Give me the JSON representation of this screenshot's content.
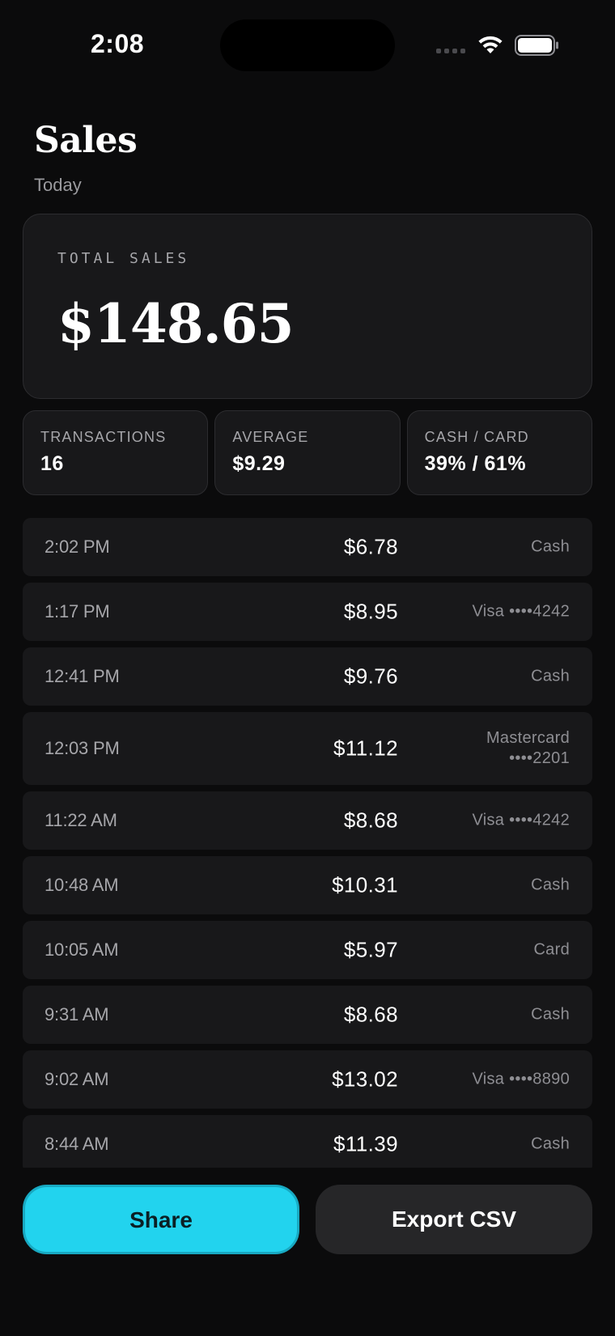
{
  "status_bar": {
    "time": "2:08"
  },
  "header": {
    "title": "Sales",
    "subtitle": "Today"
  },
  "total_card": {
    "label": "TOTAL SALES",
    "value": "$148.65"
  },
  "stats": [
    {
      "label": "TRANSACTIONS",
      "value": "16"
    },
    {
      "label": "AVERAGE",
      "value": "$9.29"
    },
    {
      "label": "CASH / CARD",
      "value": "39% / 61%"
    }
  ],
  "transactions": [
    {
      "time": "2:02 PM",
      "amount": "$6.78",
      "method": [
        "Cash"
      ]
    },
    {
      "time": "1:17 PM",
      "amount": "$8.95",
      "method": [
        "Visa ••••4242"
      ]
    },
    {
      "time": "12:41 PM",
      "amount": "$9.76",
      "method": [
        "Cash"
      ]
    },
    {
      "time": "12:03 PM",
      "amount": "$11.12",
      "method": [
        "Mastercard",
        "••••2201"
      ]
    },
    {
      "time": "11:22 AM",
      "amount": "$8.68",
      "method": [
        "Visa ••••4242"
      ]
    },
    {
      "time": "10:48 AM",
      "amount": "$10.31",
      "method": [
        "Cash"
      ]
    },
    {
      "time": "10:05 AM",
      "amount": "$5.97",
      "method": [
        "Card"
      ]
    },
    {
      "time": "9:31 AM",
      "amount": "$8.68",
      "method": [
        "Cash"
      ]
    },
    {
      "time": "9:02 AM",
      "amount": "$13.02",
      "method": [
        "Visa ••••8890"
      ]
    },
    {
      "time": "8:44 AM",
      "amount": "$11.39",
      "method": [
        "Cash"
      ]
    }
  ],
  "actions": {
    "share_label": "Share",
    "export_label": "Export CSV"
  },
  "icons": {
    "signal": "cellular-signal-icon",
    "wifi": "wifi-icon",
    "battery": "battery-icon"
  },
  "colors": {
    "background": "#0b0b0c",
    "card": "#18181a",
    "accent": "#22d3ee",
    "secondary_button": "#262628"
  }
}
